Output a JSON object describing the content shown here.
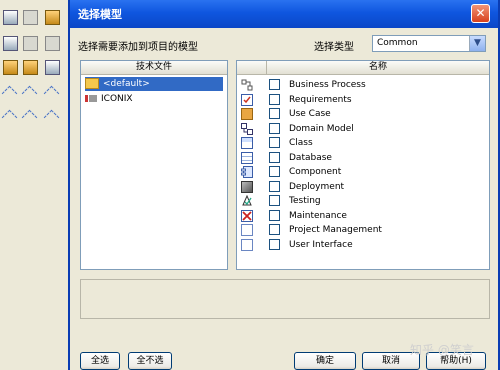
{
  "dialog": {
    "title": "选择模型",
    "close_glyph": "✕",
    "instruction": "选择需要添加到项目的模型",
    "select_type_label": "选择类型",
    "select_type_value": "Common",
    "dropdown_glyph": "▼"
  },
  "tech_panel": {
    "header": "技术文件",
    "items": [
      {
        "label": "<default>",
        "selected": true,
        "icon": "folder-icon"
      },
      {
        "label": "ICONIX",
        "selected": false,
        "icon": "package-icon"
      }
    ]
  },
  "model_panel": {
    "header": "名称",
    "items": [
      {
        "label": "Business Process",
        "icon": "business-process-icon",
        "checked": false
      },
      {
        "label": "Requirements",
        "icon": "requirements-icon",
        "checked": false
      },
      {
        "label": "Use Case",
        "icon": "use-case-icon",
        "checked": false
      },
      {
        "label": "Domain Model",
        "icon": "domain-model-icon",
        "checked": false
      },
      {
        "label": "Class",
        "icon": "class-icon",
        "checked": false
      },
      {
        "label": "Database",
        "icon": "database-icon",
        "checked": false
      },
      {
        "label": "Component",
        "icon": "component-icon",
        "checked": false
      },
      {
        "label": "Deployment",
        "icon": "deployment-icon",
        "checked": false
      },
      {
        "label": "Testing",
        "icon": "testing-icon",
        "checked": false
      },
      {
        "label": "Maintenance",
        "icon": "maintenance-icon",
        "checked": false
      },
      {
        "label": "Project Management",
        "icon": "project-management-icon",
        "checked": false
      },
      {
        "label": "User Interface",
        "icon": "user-interface-icon",
        "checked": false
      }
    ]
  },
  "buttons": {
    "select_all": "全选",
    "select_none": "全不选",
    "ok": "确定",
    "cancel": "取消",
    "help": "帮助(H)"
  },
  "watermark": "知乎 @笑言",
  "colors": {
    "title_bar": "#0f56df",
    "selection": "#316ac5",
    "dialog_bg": "#ece9d8"
  }
}
